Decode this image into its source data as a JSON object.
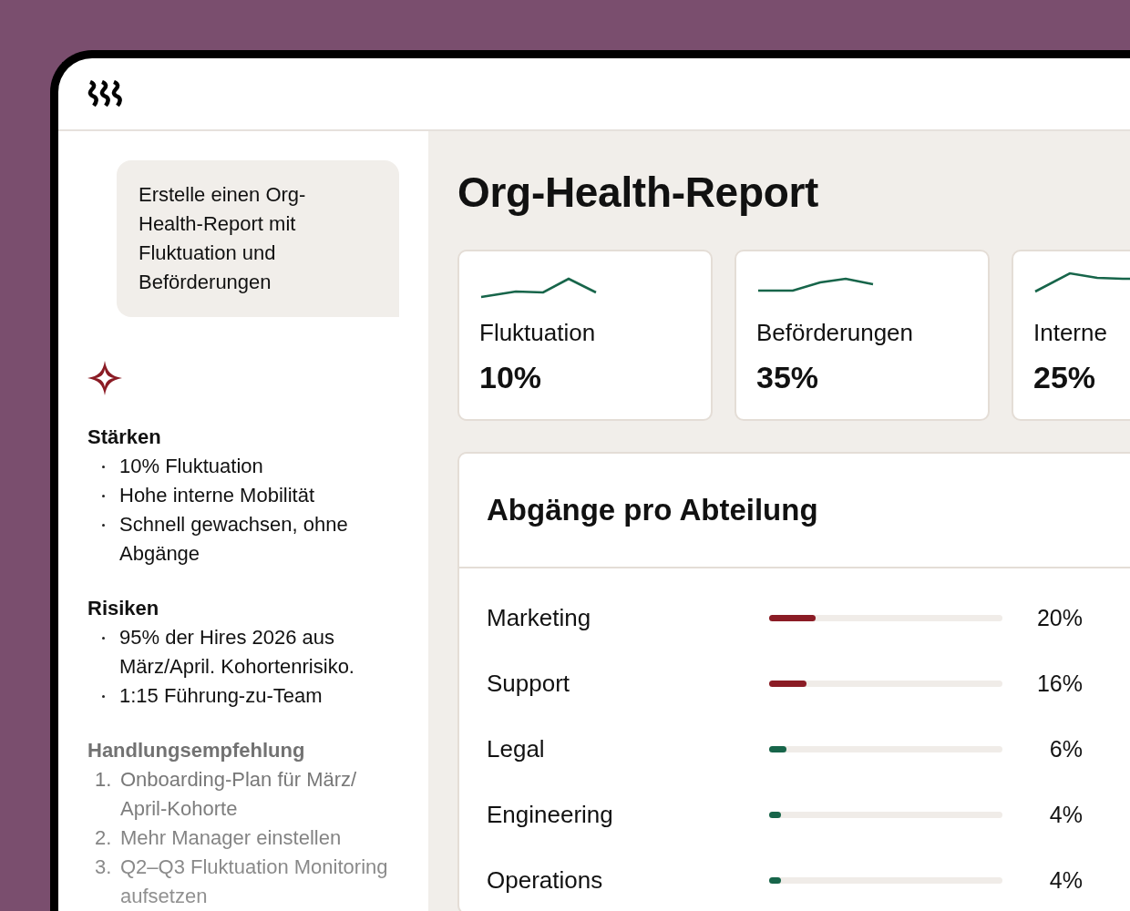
{
  "prompt": "Erstelle einen Org-Health-Report mit Fluktuation und Beförderungen",
  "summary": [
    {
      "kind": "bullets",
      "heading": "Stärken",
      "items": [
        "10% Fluktuation",
        "Hohe interne Mobilität",
        "Schnell gewachsen, ohne Abgänge"
      ]
    },
    {
      "kind": "bullets",
      "heading": "Risiken",
      "items": [
        "95% der Hires 2026 aus März/April. Kohortenrisiko.",
        "1:15 Führung-zu-Team"
      ]
    },
    {
      "kind": "numbered",
      "heading": "Handlungsempfehlung",
      "items": [
        {
          "number": "1.",
          "text": "Onboarding-Plan für März/ April-Kohorte"
        },
        {
          "number": "2.",
          "text": "Mehr Manager einstellen"
        },
        {
          "number": "3.",
          "text": "Q2–Q3 Fluktuation Monitoring aufsetzen"
        }
      ]
    }
  ],
  "report": {
    "title": "Org-Health-Report",
    "cards": [
      {
        "label": "Fluktuation",
        "value": "10%"
      },
      {
        "label": "Beförderungen",
        "value": "35%"
      },
      {
        "label": "Interne",
        "value": "25%"
      }
    ],
    "departures": {
      "title": "Abgänge pro Abteilung",
      "rows": [
        {
          "name": "Marketing",
          "level": 0.2,
          "color": "#8b1c25",
          "reading": "20%"
        },
        {
          "name": "Support",
          "level": 0.16,
          "color": "#8b1c25",
          "reading": "16%"
        },
        {
          "name": "Legal",
          "level": 0.075,
          "color": "#17654a",
          "reading": "6%"
        },
        {
          "name": "Engineering",
          "level": 0.05,
          "color": "#17654a",
          "reading": "4%"
        },
        {
          "name": "Operations",
          "level": 0.05,
          "color": "#17654a",
          "reading": "4%"
        }
      ]
    }
  }
}
